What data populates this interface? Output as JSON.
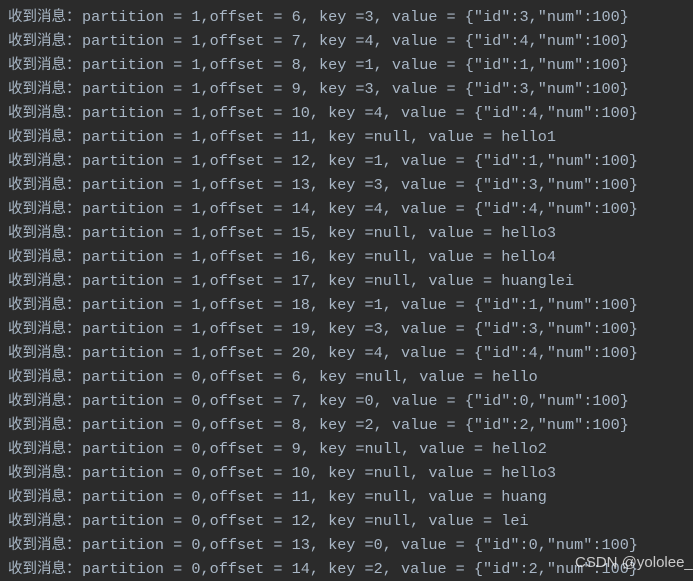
{
  "console": {
    "prefix": "收到消息：",
    "lines": [
      "partition = 1,offset = 6, key =3, value = {\"id\":3,\"num\":100}",
      "partition = 1,offset = 7, key =4, value = {\"id\":4,\"num\":100}",
      "partition = 1,offset = 8, key =1, value = {\"id\":1,\"num\":100}",
      "partition = 1,offset = 9, key =3, value = {\"id\":3,\"num\":100}",
      "partition = 1,offset = 10, key =4, value = {\"id\":4,\"num\":100}",
      "partition = 1,offset = 11, key =null, value = hello1",
      "partition = 1,offset = 12, key =1, value = {\"id\":1,\"num\":100}",
      "partition = 1,offset = 13, key =3, value = {\"id\":3,\"num\":100}",
      "partition = 1,offset = 14, key =4, value = {\"id\":4,\"num\":100}",
      "partition = 1,offset = 15, key =null, value = hello3",
      "partition = 1,offset = 16, key =null, value = hello4",
      "partition = 1,offset = 17, key =null, value = huanglei",
      "partition = 1,offset = 18, key =1, value = {\"id\":1,\"num\":100}",
      "partition = 1,offset = 19, key =3, value = {\"id\":3,\"num\":100}",
      "partition = 1,offset = 20, key =4, value = {\"id\":4,\"num\":100}",
      "partition = 0,offset = 6, key =null, value = hello",
      "partition = 0,offset = 7, key =0, value = {\"id\":0,\"num\":100}",
      "partition = 0,offset = 8, key =2, value = {\"id\":2,\"num\":100}",
      "partition = 0,offset = 9, key =null, value = hello2",
      "partition = 0,offset = 10, key =null, value = hello3",
      "partition = 0,offset = 11, key =null, value = huang",
      "partition = 0,offset = 12, key =null, value = lei",
      "partition = 0,offset = 13, key =0, value = {\"id\":0,\"num\":100}",
      "partition = 0,offset = 14, key =2, value = {\"id\":2,\"num\":100}"
    ]
  },
  "watermark": "CSDN @yololee_",
  "colors": {
    "background": "#2b2b2b",
    "text": "#a9b7c6"
  }
}
